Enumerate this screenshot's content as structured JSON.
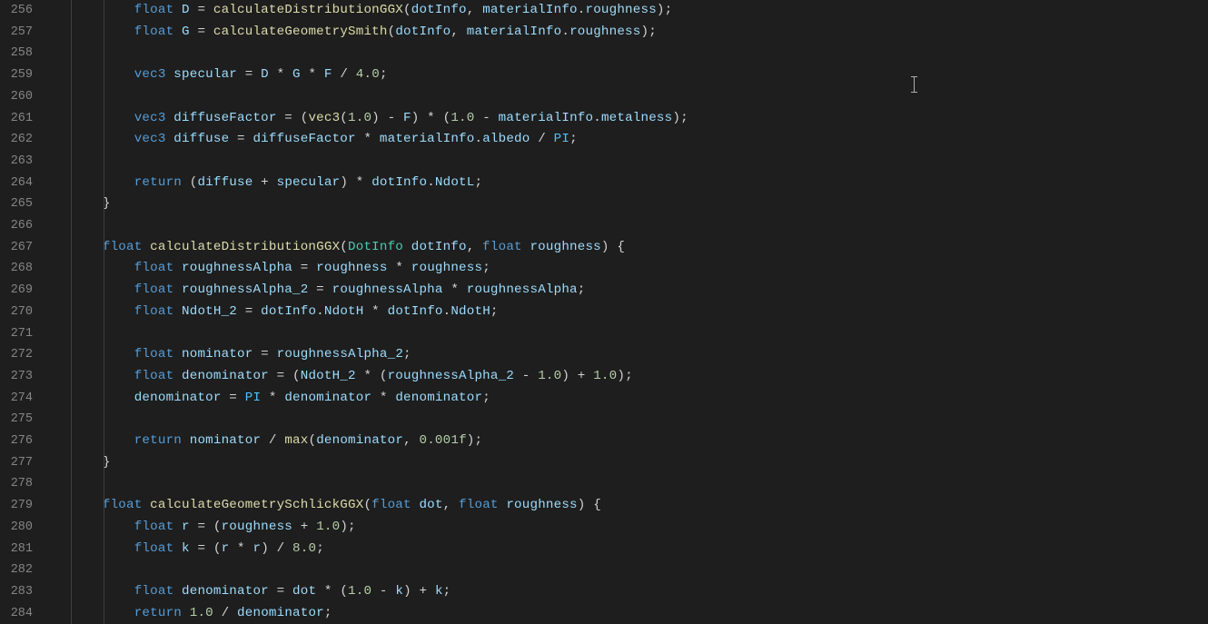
{
  "startLine": 256,
  "lines": [
    {
      "n": 256,
      "tokens": [
        {
          "t": "        ",
          "c": "op"
        },
        {
          "t": "float",
          "c": "k"
        },
        {
          "t": " ",
          "c": "op"
        },
        {
          "t": "D",
          "c": "id"
        },
        {
          "t": " = ",
          "c": "op"
        },
        {
          "t": "calculateDistributionGGX",
          "c": "fn"
        },
        {
          "t": "(",
          "c": "op"
        },
        {
          "t": "dotInfo",
          "c": "id"
        },
        {
          "t": ", ",
          "c": "op"
        },
        {
          "t": "materialInfo",
          "c": "id"
        },
        {
          "t": ".",
          "c": "op"
        },
        {
          "t": "roughness",
          "c": "id"
        },
        {
          "t": ");",
          "c": "op"
        }
      ]
    },
    {
      "n": 257,
      "tokens": [
        {
          "t": "        ",
          "c": "op"
        },
        {
          "t": "float",
          "c": "k"
        },
        {
          "t": " ",
          "c": "op"
        },
        {
          "t": "G",
          "c": "id"
        },
        {
          "t": " = ",
          "c": "op"
        },
        {
          "t": "calculateGeometrySmith",
          "c": "fn"
        },
        {
          "t": "(",
          "c": "op"
        },
        {
          "t": "dotInfo",
          "c": "id"
        },
        {
          "t": ", ",
          "c": "op"
        },
        {
          "t": "materialInfo",
          "c": "id"
        },
        {
          "t": ".",
          "c": "op"
        },
        {
          "t": "roughness",
          "c": "id"
        },
        {
          "t": ");",
          "c": "op"
        }
      ]
    },
    {
      "n": 258,
      "tokens": []
    },
    {
      "n": 259,
      "tokens": [
        {
          "t": "        ",
          "c": "op"
        },
        {
          "t": "vec3",
          "c": "k"
        },
        {
          "t": " ",
          "c": "op"
        },
        {
          "t": "specular",
          "c": "id"
        },
        {
          "t": " = ",
          "c": "op"
        },
        {
          "t": "D",
          "c": "id"
        },
        {
          "t": " * ",
          "c": "op"
        },
        {
          "t": "G",
          "c": "id"
        },
        {
          "t": " * ",
          "c": "op"
        },
        {
          "t": "F",
          "c": "id"
        },
        {
          "t": " / ",
          "c": "op"
        },
        {
          "t": "4.0",
          "c": "nm"
        },
        {
          "t": ";",
          "c": "op"
        }
      ]
    },
    {
      "n": 260,
      "tokens": []
    },
    {
      "n": 261,
      "tokens": [
        {
          "t": "        ",
          "c": "op"
        },
        {
          "t": "vec3",
          "c": "k"
        },
        {
          "t": " ",
          "c": "op"
        },
        {
          "t": "diffuseFactor",
          "c": "id"
        },
        {
          "t": " = (",
          "c": "op"
        },
        {
          "t": "vec3",
          "c": "fn"
        },
        {
          "t": "(",
          "c": "op"
        },
        {
          "t": "1.0",
          "c": "nm"
        },
        {
          "t": ") - ",
          "c": "op"
        },
        {
          "t": "F",
          "c": "id"
        },
        {
          "t": ") * (",
          "c": "op"
        },
        {
          "t": "1.0",
          "c": "nm"
        },
        {
          "t": " - ",
          "c": "op"
        },
        {
          "t": "materialInfo",
          "c": "id"
        },
        {
          "t": ".",
          "c": "op"
        },
        {
          "t": "metalness",
          "c": "id"
        },
        {
          "t": ");",
          "c": "op"
        }
      ]
    },
    {
      "n": 262,
      "tokens": [
        {
          "t": "        ",
          "c": "op"
        },
        {
          "t": "vec3",
          "c": "k"
        },
        {
          "t": " ",
          "c": "op"
        },
        {
          "t": "diffuse",
          "c": "id"
        },
        {
          "t": " = ",
          "c": "op"
        },
        {
          "t": "diffuseFactor",
          "c": "id"
        },
        {
          "t": " * ",
          "c": "op"
        },
        {
          "t": "materialInfo",
          "c": "id"
        },
        {
          "t": ".",
          "c": "op"
        },
        {
          "t": "albedo",
          "c": "id"
        },
        {
          "t": " / ",
          "c": "op"
        },
        {
          "t": "PI",
          "c": "cn"
        },
        {
          "t": ";",
          "c": "op"
        }
      ]
    },
    {
      "n": 263,
      "tokens": []
    },
    {
      "n": 264,
      "tokens": [
        {
          "t": "        ",
          "c": "op"
        },
        {
          "t": "return",
          "c": "k"
        },
        {
          "t": " (",
          "c": "op"
        },
        {
          "t": "diffuse",
          "c": "id"
        },
        {
          "t": " + ",
          "c": "op"
        },
        {
          "t": "specular",
          "c": "id"
        },
        {
          "t": ") * ",
          "c": "op"
        },
        {
          "t": "dotInfo",
          "c": "id"
        },
        {
          "t": ".",
          "c": "op"
        },
        {
          "t": "NdotL",
          "c": "id"
        },
        {
          "t": ";",
          "c": "op"
        }
      ]
    },
    {
      "n": 265,
      "tokens": [
        {
          "t": "    }",
          "c": "op"
        }
      ]
    },
    {
      "n": 266,
      "tokens": []
    },
    {
      "n": 267,
      "tokens": [
        {
          "t": "    ",
          "c": "op"
        },
        {
          "t": "float",
          "c": "k"
        },
        {
          "t": " ",
          "c": "op"
        },
        {
          "t": "calculateDistributionGGX",
          "c": "fn"
        },
        {
          "t": "(",
          "c": "op"
        },
        {
          "t": "DotInfo",
          "c": "ty"
        },
        {
          "t": " ",
          "c": "op"
        },
        {
          "t": "dotInfo",
          "c": "id"
        },
        {
          "t": ", ",
          "c": "op"
        },
        {
          "t": "float",
          "c": "k"
        },
        {
          "t": " ",
          "c": "op"
        },
        {
          "t": "roughness",
          "c": "id"
        },
        {
          "t": ") {",
          "c": "op"
        }
      ]
    },
    {
      "n": 268,
      "tokens": [
        {
          "t": "        ",
          "c": "op"
        },
        {
          "t": "float",
          "c": "k"
        },
        {
          "t": " ",
          "c": "op"
        },
        {
          "t": "roughnessAlpha",
          "c": "id"
        },
        {
          "t": " = ",
          "c": "op"
        },
        {
          "t": "roughness",
          "c": "id"
        },
        {
          "t": " * ",
          "c": "op"
        },
        {
          "t": "roughness",
          "c": "id"
        },
        {
          "t": ";",
          "c": "op"
        }
      ]
    },
    {
      "n": 269,
      "tokens": [
        {
          "t": "        ",
          "c": "op"
        },
        {
          "t": "float",
          "c": "k"
        },
        {
          "t": " ",
          "c": "op"
        },
        {
          "t": "roughnessAlpha_2",
          "c": "id"
        },
        {
          "t": " = ",
          "c": "op"
        },
        {
          "t": "roughnessAlpha",
          "c": "id"
        },
        {
          "t": " * ",
          "c": "op"
        },
        {
          "t": "roughnessAlpha",
          "c": "id"
        },
        {
          "t": ";",
          "c": "op"
        }
      ]
    },
    {
      "n": 270,
      "tokens": [
        {
          "t": "        ",
          "c": "op"
        },
        {
          "t": "float",
          "c": "k"
        },
        {
          "t": " ",
          "c": "op"
        },
        {
          "t": "NdotH_2",
          "c": "id"
        },
        {
          "t": " = ",
          "c": "op"
        },
        {
          "t": "dotInfo",
          "c": "id"
        },
        {
          "t": ".",
          "c": "op"
        },
        {
          "t": "NdotH",
          "c": "id"
        },
        {
          "t": " * ",
          "c": "op"
        },
        {
          "t": "dotInfo",
          "c": "id"
        },
        {
          "t": ".",
          "c": "op"
        },
        {
          "t": "NdotH",
          "c": "id"
        },
        {
          "t": ";",
          "c": "op"
        }
      ]
    },
    {
      "n": 271,
      "tokens": []
    },
    {
      "n": 272,
      "tokens": [
        {
          "t": "        ",
          "c": "op"
        },
        {
          "t": "float",
          "c": "k"
        },
        {
          "t": " ",
          "c": "op"
        },
        {
          "t": "nominator",
          "c": "id"
        },
        {
          "t": " = ",
          "c": "op"
        },
        {
          "t": "roughnessAlpha_2",
          "c": "id"
        },
        {
          "t": ";",
          "c": "op"
        }
      ]
    },
    {
      "n": 273,
      "tokens": [
        {
          "t": "        ",
          "c": "op"
        },
        {
          "t": "float",
          "c": "k"
        },
        {
          "t": " ",
          "c": "op"
        },
        {
          "t": "denominator",
          "c": "id"
        },
        {
          "t": " = (",
          "c": "op"
        },
        {
          "t": "NdotH_2",
          "c": "id"
        },
        {
          "t": " * (",
          "c": "op"
        },
        {
          "t": "roughnessAlpha_2",
          "c": "id"
        },
        {
          "t": " - ",
          "c": "op"
        },
        {
          "t": "1.0",
          "c": "nm"
        },
        {
          "t": ") + ",
          "c": "op"
        },
        {
          "t": "1.0",
          "c": "nm"
        },
        {
          "t": ");",
          "c": "op"
        }
      ]
    },
    {
      "n": 274,
      "tokens": [
        {
          "t": "        ",
          "c": "op"
        },
        {
          "t": "denominator",
          "c": "id"
        },
        {
          "t": " = ",
          "c": "op"
        },
        {
          "t": "PI",
          "c": "cn"
        },
        {
          "t": " * ",
          "c": "op"
        },
        {
          "t": "denominator",
          "c": "id"
        },
        {
          "t": " * ",
          "c": "op"
        },
        {
          "t": "denominator",
          "c": "id"
        },
        {
          "t": ";",
          "c": "op"
        }
      ]
    },
    {
      "n": 275,
      "tokens": []
    },
    {
      "n": 276,
      "tokens": [
        {
          "t": "        ",
          "c": "op"
        },
        {
          "t": "return",
          "c": "k"
        },
        {
          "t": " ",
          "c": "op"
        },
        {
          "t": "nominator",
          "c": "id"
        },
        {
          "t": " / ",
          "c": "op"
        },
        {
          "t": "max",
          "c": "fn"
        },
        {
          "t": "(",
          "c": "op"
        },
        {
          "t": "denominator",
          "c": "id"
        },
        {
          "t": ", ",
          "c": "op"
        },
        {
          "t": "0.001f",
          "c": "nm"
        },
        {
          "t": ");",
          "c": "op"
        }
      ]
    },
    {
      "n": 277,
      "tokens": [
        {
          "t": "    }",
          "c": "op"
        }
      ]
    },
    {
      "n": 278,
      "tokens": []
    },
    {
      "n": 279,
      "tokens": [
        {
          "t": "    ",
          "c": "op"
        },
        {
          "t": "float",
          "c": "k"
        },
        {
          "t": " ",
          "c": "op"
        },
        {
          "t": "calculateGeometrySchlickGGX",
          "c": "fn"
        },
        {
          "t": "(",
          "c": "op"
        },
        {
          "t": "float",
          "c": "k"
        },
        {
          "t": " ",
          "c": "op"
        },
        {
          "t": "dot",
          "c": "id"
        },
        {
          "t": ", ",
          "c": "op"
        },
        {
          "t": "float",
          "c": "k"
        },
        {
          "t": " ",
          "c": "op"
        },
        {
          "t": "roughness",
          "c": "id"
        },
        {
          "t": ") {",
          "c": "op"
        }
      ]
    },
    {
      "n": 280,
      "tokens": [
        {
          "t": "        ",
          "c": "op"
        },
        {
          "t": "float",
          "c": "k"
        },
        {
          "t": " ",
          "c": "op"
        },
        {
          "t": "r",
          "c": "id"
        },
        {
          "t": " = (",
          "c": "op"
        },
        {
          "t": "roughness",
          "c": "id"
        },
        {
          "t": " + ",
          "c": "op"
        },
        {
          "t": "1.0",
          "c": "nm"
        },
        {
          "t": ");",
          "c": "op"
        }
      ]
    },
    {
      "n": 281,
      "tokens": [
        {
          "t": "        ",
          "c": "op"
        },
        {
          "t": "float",
          "c": "k"
        },
        {
          "t": " ",
          "c": "op"
        },
        {
          "t": "k",
          "c": "id"
        },
        {
          "t": " = (",
          "c": "op"
        },
        {
          "t": "r",
          "c": "id"
        },
        {
          "t": " * ",
          "c": "op"
        },
        {
          "t": "r",
          "c": "id"
        },
        {
          "t": ") / ",
          "c": "op"
        },
        {
          "t": "8.0",
          "c": "nm"
        },
        {
          "t": ";",
          "c": "op"
        }
      ]
    },
    {
      "n": 282,
      "tokens": []
    },
    {
      "n": 283,
      "tokens": [
        {
          "t": "        ",
          "c": "op"
        },
        {
          "t": "float",
          "c": "k"
        },
        {
          "t": " ",
          "c": "op"
        },
        {
          "t": "denominator",
          "c": "id"
        },
        {
          "t": " = ",
          "c": "op"
        },
        {
          "t": "dot",
          "c": "id"
        },
        {
          "t": " * (",
          "c": "op"
        },
        {
          "t": "1.0",
          "c": "nm"
        },
        {
          "t": " - ",
          "c": "op"
        },
        {
          "t": "k",
          "c": "id"
        },
        {
          "t": ") + ",
          "c": "op"
        },
        {
          "t": "k",
          "c": "id"
        },
        {
          "t": ";",
          "c": "op"
        }
      ]
    },
    {
      "n": 284,
      "tokens": [
        {
          "t": "        ",
          "c": "op"
        },
        {
          "t": "return",
          "c": "k"
        },
        {
          "t": " ",
          "c": "op"
        },
        {
          "t": "1.0",
          "c": "nm"
        },
        {
          "t": " / ",
          "c": "op"
        },
        {
          "t": "denominator",
          "c": "id"
        },
        {
          "t": ";",
          "c": "op"
        }
      ]
    }
  ]
}
